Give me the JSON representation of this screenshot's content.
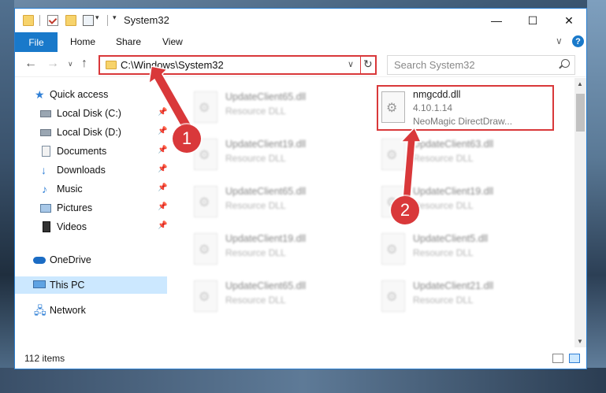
{
  "window": {
    "title": "System32"
  },
  "ribbon": {
    "file": "File",
    "tabs": [
      "Home",
      "Share",
      "View"
    ]
  },
  "titlebar": {
    "minimize": "—",
    "maximize": "☐",
    "close": "✕"
  },
  "nav": {
    "back": "←",
    "forward": "→",
    "recent": "∨",
    "up": "↑",
    "address": "C:\\Windows\\System32",
    "search_placeholder": "Search System32"
  },
  "sidebar": {
    "items": [
      {
        "label": "Quick access",
        "icon": "star-icon"
      },
      {
        "label": "Local Disk (C:)",
        "icon": "disk-icon",
        "pinned": true
      },
      {
        "label": "Local Disk (D:)",
        "icon": "disk-icon",
        "pinned": true
      },
      {
        "label": "Documents",
        "icon": "documents-icon",
        "pinned": true
      },
      {
        "label": "Downloads",
        "icon": "downloads-icon",
        "pinned": true
      },
      {
        "label": "Music",
        "icon": "music-icon",
        "pinned": true
      },
      {
        "label": "Pictures",
        "icon": "pictures-icon",
        "pinned": true
      },
      {
        "label": "Videos",
        "icon": "videos-icon",
        "pinned": true
      },
      {
        "label": "OneDrive",
        "icon": "cloud-icon"
      },
      {
        "label": "This PC",
        "icon": "computer-icon",
        "selected": true
      },
      {
        "label": "Network",
        "icon": "network-icon"
      }
    ]
  },
  "files": [
    {
      "name": "UpdateClient65.dll",
      "sub": "Resource DLL"
    },
    {
      "name": "nmgcdd.dll",
      "version": "4.10.1.14",
      "sub": "NeoMagic DirectDraw..."
    },
    {
      "name": "UpdateClient19.dll",
      "sub": "Resource DLL"
    },
    {
      "name": "UpdateClient63.dll",
      "sub": "Resource DLL"
    },
    {
      "name": "UpdateClient65.dll",
      "sub": "Resource DLL"
    },
    {
      "name": "UpdateClient19.dll",
      "sub": "Resource DLL"
    },
    {
      "name": "UpdateClient19.dll",
      "sub": "Resource DLL"
    },
    {
      "name": "UpdateClient5.dll",
      "sub": "Resource DLL"
    },
    {
      "name": "UpdateClient65.dll",
      "sub": "Resource DLL"
    },
    {
      "name": "UpdateClient21.dll",
      "sub": "Resource DLL"
    }
  ],
  "status": {
    "items": "112 items"
  },
  "annotations": {
    "badge1": "1",
    "badge2": "2"
  },
  "colors": {
    "accent": "#1979ca",
    "highlight": "#d9383a",
    "selected": "#cce8ff"
  }
}
